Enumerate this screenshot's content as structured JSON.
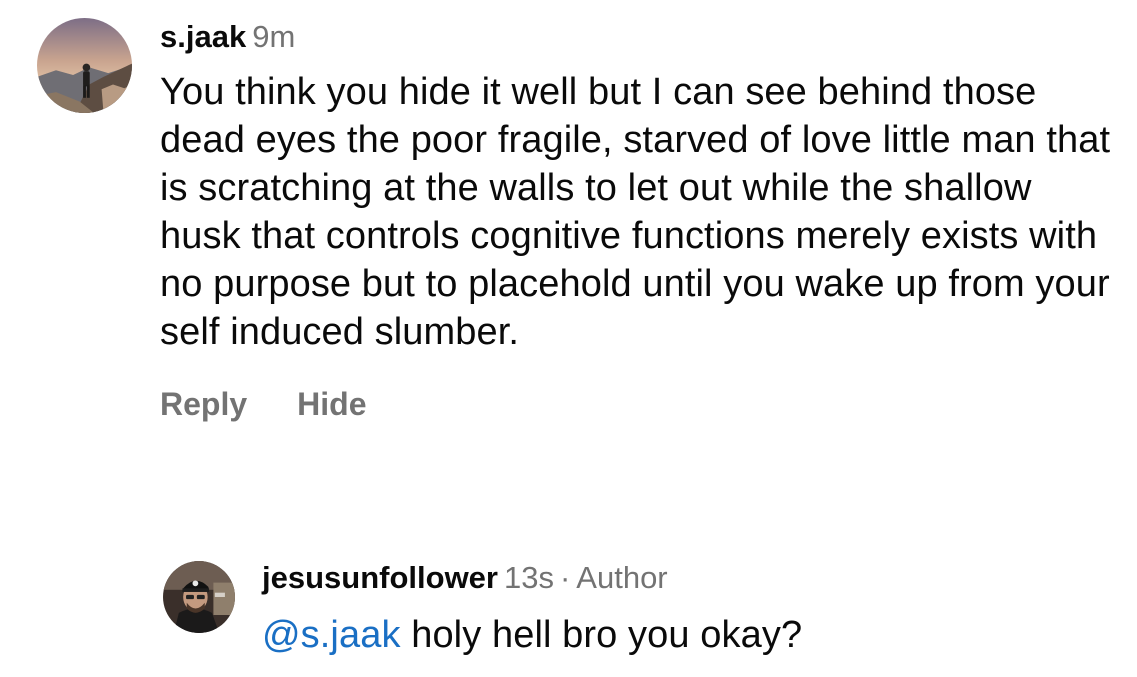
{
  "comment": {
    "username": "s.jaak",
    "time": "9m",
    "text": "You think you hide it well but I can see behind those dead eyes the poor fragile, starved of love little man that is scratching at the walls to let out while the shallow husk that controls cognitive functions merely exists with no purpose but to placehold until you wake up from your self induced slumber.",
    "reply_label": "Reply",
    "hide_label": "Hide"
  },
  "reply": {
    "username": "jesusunfollower",
    "time": "13s",
    "separator": "·",
    "badge": "Author",
    "mention": "@s.jaak",
    "text": " holy hell bro you okay?"
  },
  "colors": {
    "text": "#0a0a0a",
    "secondary": "#737373",
    "mention": "#1a6fc4"
  }
}
